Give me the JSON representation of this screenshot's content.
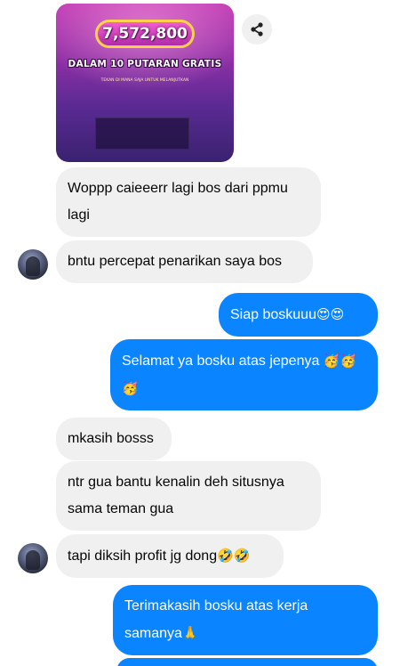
{
  "image_message": {
    "amount": "7,572,800",
    "headline": "DALAM 10 PUTARAN GRATIS",
    "fine_print": "TEKAN DI MANA SAJA UNTUK MELANJUTKAN"
  },
  "icons": {
    "share": "share-icon"
  },
  "messages": [
    {
      "id": "m1",
      "side": "in",
      "text": "Woppp caieeerr lagi bos dari ppmu lagi"
    },
    {
      "id": "m2",
      "side": "in",
      "text": "bntu percepat penarikan saya bos"
    },
    {
      "id": "m3",
      "side": "out",
      "text": "Siap boskuuu",
      "emoji": "😍😍"
    },
    {
      "id": "m4",
      "side": "out",
      "text": "Selamat ya bosku atas jepenya",
      "emoji": "🥳🥳🥳"
    },
    {
      "id": "m5",
      "side": "in",
      "text": "mkasih bosss"
    },
    {
      "id": "m6",
      "side": "in",
      "text": "ntr gua bantu kenalin deh situsnya sama teman gua"
    },
    {
      "id": "m7",
      "side": "in",
      "text": "tapi diksih profit jg dong",
      "emoji": "🤣🤣"
    },
    {
      "id": "m8",
      "side": "out",
      "text": "Terimakasih bosku atas kerja samanya",
      "emoji": "🙏"
    }
  ]
}
